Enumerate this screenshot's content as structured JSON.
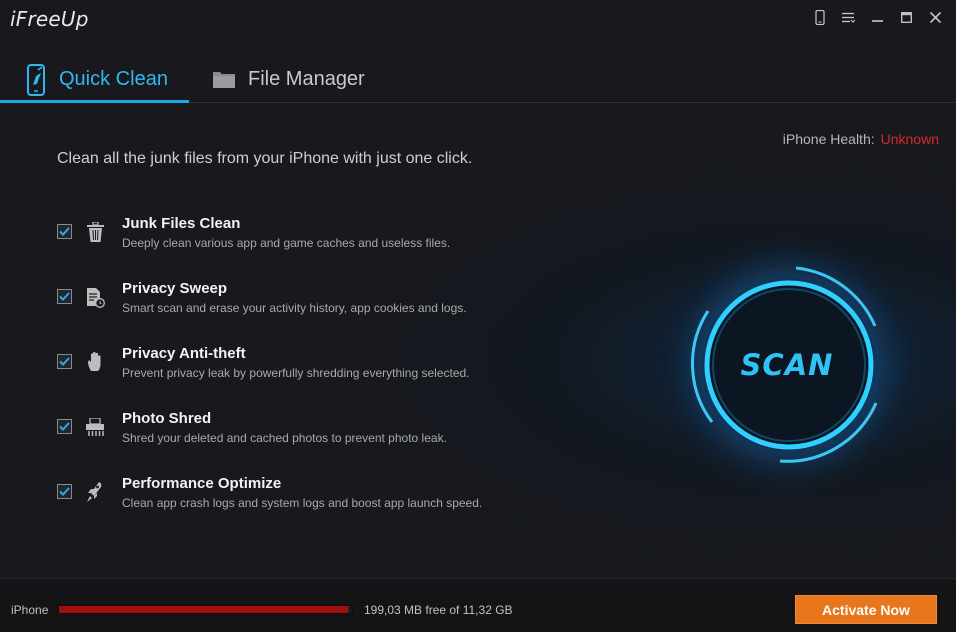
{
  "app": {
    "title": "iFreeUp"
  },
  "window_controls": [
    {
      "name": "phone-icon"
    },
    {
      "name": "menu-icon"
    },
    {
      "name": "minimize-icon"
    },
    {
      "name": "maximize-icon"
    },
    {
      "name": "close-icon"
    }
  ],
  "tabs": [
    {
      "label": "Quick Clean",
      "icon": "phone-clean-icon",
      "active": true
    },
    {
      "label": "File Manager",
      "icon": "folder-icon",
      "active": false
    }
  ],
  "health": {
    "label": "iPhone Health:",
    "value": "Unknown",
    "value_color": "#d7292a"
  },
  "intro": "Clean all the junk files from your iPhone with just one click.",
  "features": [
    {
      "title": "Junk Files Clean",
      "desc": "Deeply clean various app and game caches and useless files.",
      "icon": "trash-icon",
      "checked": true
    },
    {
      "title": "Privacy Sweep",
      "desc": "Smart scan and erase your activity history, app cookies and logs.",
      "icon": "document-clock-icon",
      "checked": true
    },
    {
      "title": "Privacy Anti-theft",
      "desc": "Prevent privacy leak by powerfully shredding everything selected.",
      "icon": "hand-icon",
      "checked": true
    },
    {
      "title": "Photo Shred",
      "desc": "Shred your deleted and cached photos to prevent photo leak.",
      "icon": "shredder-icon",
      "checked": true
    },
    {
      "title": "Performance Optimize",
      "desc": "Clean app crash logs and system logs and boost app launch speed.",
      "icon": "rocket-icon",
      "checked": true
    }
  ],
  "scan": {
    "label": "SCAN"
  },
  "footer": {
    "device": "iPhone",
    "storage_used_fraction": 0.985,
    "storage_text": "199,03 MB free of 11,32 GB",
    "activate_label": "Activate Now"
  },
  "colors": {
    "accent": "#1ea7e8",
    "scan_ring": "#2fc3f5",
    "storage_bar": "#a0100f",
    "activate_button": "#e8761c"
  }
}
